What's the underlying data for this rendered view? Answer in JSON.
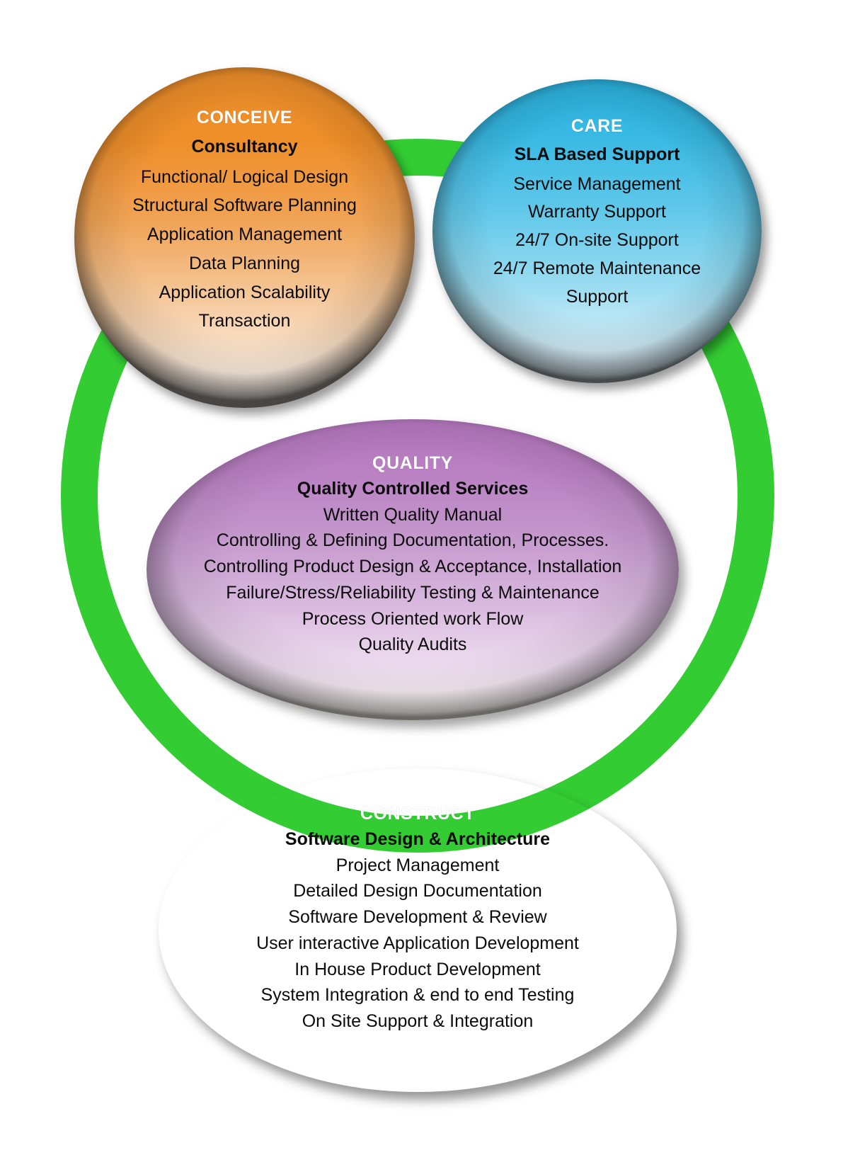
{
  "diagram": {
    "ring": {
      "color": "#33cc33",
      "name": "process-cycle-ring"
    },
    "nodes": [
      {
        "id": "conceive",
        "title": "CONCEIVE",
        "subtitle": "Consultancy",
        "accent": "#ef8f2a",
        "title_color": "#ffffff",
        "items": [
          "Functional/ Logical Design",
          "Structural Software Planning",
          "Application Management",
          "Data Planning",
          "Application Scalability",
          "Transaction"
        ]
      },
      {
        "id": "care",
        "title": "CARE",
        "subtitle": "SLA Based Support",
        "accent": "#2bb3e0",
        "title_color": "#ffffff",
        "items": [
          "Service Management",
          "Warranty Support",
          "24/7 On-site Support",
          "24/7 Remote Maintenance",
          "Support"
        ]
      },
      {
        "id": "quality",
        "title": "QUALITY",
        "subtitle": "Quality Controlled Services",
        "accent": "#b375bd",
        "title_color": "#ffffff",
        "items": [
          "Written Quality Manual",
          "Controlling & Defining Documentation, Processes.",
          "Controlling Product Design & Acceptance, Installation",
          "Failure/Stress/Reliability Testing &  Maintenance",
          "Process Oriented work Flow",
          "Quality Audits"
        ]
      },
      {
        "id": "construct",
        "title": "CONSTRUCT",
        "subtitle": "Software Design & Architecture",
        "accent": "#c39a4e",
        "title_color": "#ffffff",
        "items": [
          "Project Management",
          "Detailed Design Documentation",
          "Software Development & Review",
          "User interactive Application Development",
          "In House Product Development",
          "System Integration & end to end Testing",
          "On Site Support & Integration"
        ]
      }
    ]
  }
}
